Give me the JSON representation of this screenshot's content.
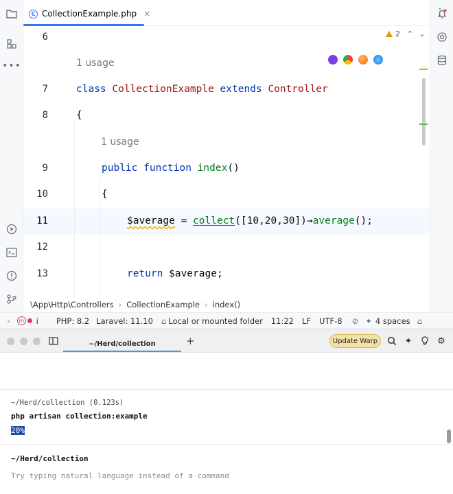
{
  "ide": {
    "tab": {
      "label": "CollectionExample.php",
      "close": "×"
    },
    "warnings": "2",
    "lines": [
      {
        "num": "6"
      },
      {
        "num": "7"
      },
      {
        "num": "8"
      },
      {
        "num": "9"
      },
      {
        "num": "10"
      },
      {
        "num": "11"
      },
      {
        "num": "12"
      },
      {
        "num": "13"
      }
    ],
    "inlay_class": "1 usage",
    "inlay_method": "1 usage",
    "code": {
      "l7_kw1": "class",
      "l7_cls": "CollectionExample",
      "l7_kw2": "extends",
      "l7_parent": "Controller",
      "l8": "{",
      "l9_kw1": "public",
      "l9_kw2": "function",
      "l9_fn": "index",
      "l9_rest": "()",
      "l10": "{",
      "l11_var": "$average",
      "l11_eq": " = ",
      "l11_fn": "collect",
      "l11_args": "([10,20,30])",
      "l11_arrow": "→",
      "l11_method": "average",
      "l11_end": "();",
      "l13_kw": "return",
      "l13_rest": " $average;"
    },
    "breadcrumb": [
      "\\App\\Http\\Controllers",
      "CollectionExample",
      "index()"
    ],
    "status": {
      "php": "PHP: 8.2",
      "laravel": "Laravel: 11.10",
      "folder": "Local or mounted folder",
      "pos": "11:22",
      "eol": "LF",
      "enc": "UTF-8",
      "indent": "4 spaces",
      "mode": "i"
    }
  },
  "terminal": {
    "tab": "~/Herd/collection",
    "update": "Update Warp",
    "block1": {
      "header": "~/Herd/collection (0.123s)",
      "command": "php artisan collection:example",
      "output": "20%"
    },
    "prompt": {
      "path": "~/Herd/collection",
      "placeholder": "Try typing natural language instead of a command"
    }
  }
}
